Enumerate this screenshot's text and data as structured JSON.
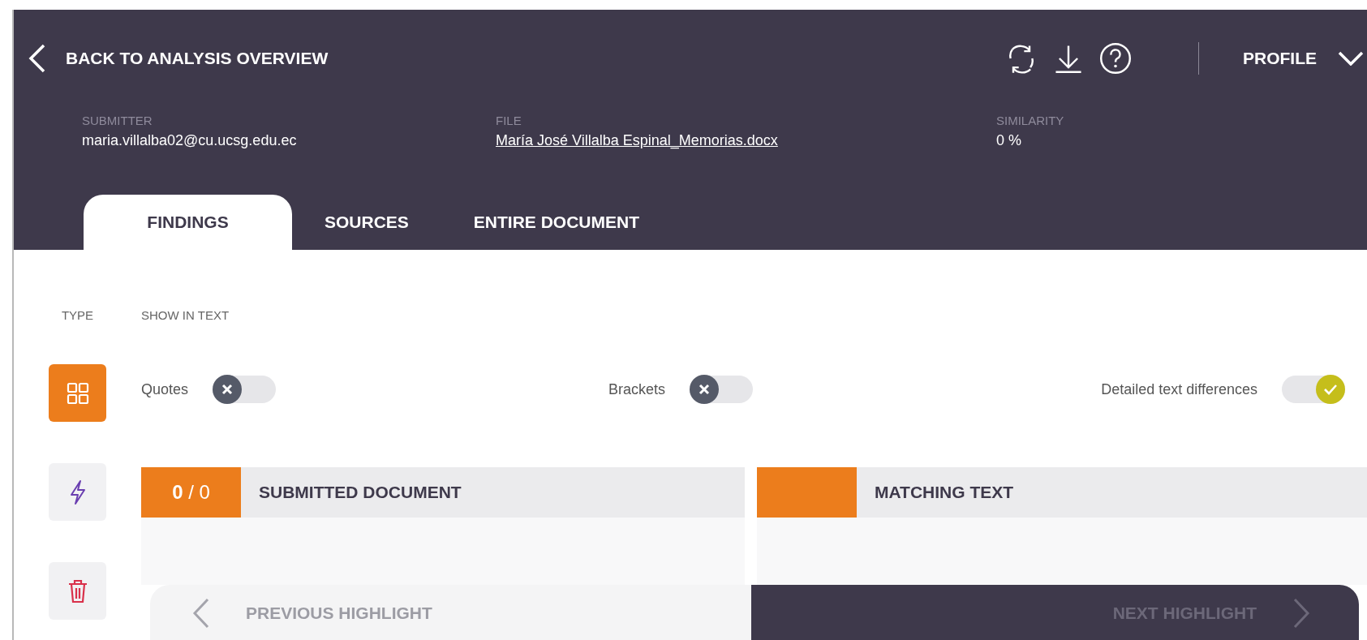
{
  "header": {
    "back_label": "BACK TO ANALYSIS OVERVIEW",
    "profile_label": "PROFILE",
    "meta": [
      {
        "label": "SUBMITTER",
        "value": "maria.villalba02@cu.ucsg.edu.ec",
        "kind": "text"
      },
      {
        "label": "FILE",
        "value": "María José Villalba Espinal_Memorias.docx",
        "kind": "link"
      },
      {
        "label": "SIMILARITY",
        "value": "0 %",
        "kind": "text"
      }
    ]
  },
  "tabs": [
    {
      "label": "FINDINGS",
      "selected": true
    },
    {
      "label": "SOURCES",
      "selected": false
    },
    {
      "label": "ENTIRE DOCUMENT",
      "selected": false
    }
  ],
  "type_label": "TYPE",
  "show_label": "SHOW IN TEXT",
  "type_filters": [
    {
      "kind": "grid",
      "selected": true
    },
    {
      "kind": "bolt",
      "selected": false
    },
    {
      "kind": "trash",
      "selected": false
    }
  ],
  "toggles": [
    {
      "label": "Quotes",
      "on": false
    },
    {
      "label": "Brackets",
      "on": false
    },
    {
      "label": "Detailed text differences",
      "on": true
    }
  ],
  "panels": [
    {
      "title": "SUBMITTED DOCUMENT",
      "counter": "**0** / 0"
    },
    {
      "title": "MATCHING TEXT"
    }
  ],
  "navigation": {
    "previous": {
      "label": "PREVIOUS HIGHLIGHT",
      "disabled": true
    },
    "next": {
      "label": "NEXT HIGHLIGHT",
      "disabled": true
    }
  }
}
